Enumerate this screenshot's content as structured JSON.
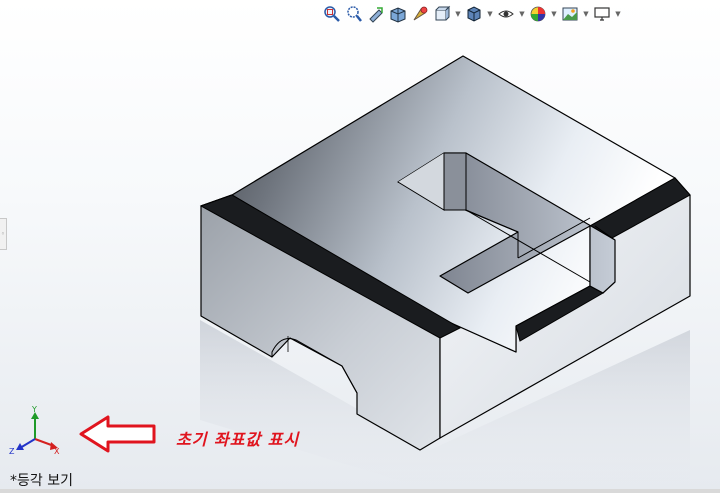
{
  "toolbar": {
    "icons": [
      {
        "name": "zoom-to-fit-icon",
        "caret": false
      },
      {
        "name": "zoom-to-area-icon",
        "caret": false
      },
      {
        "name": "previous-view-icon",
        "caret": false
      },
      {
        "name": "section-view-icon",
        "caret": false
      },
      {
        "name": "dynamic-annotation-icon",
        "caret": false
      },
      {
        "name": "view-orientation-icon",
        "caret": true
      },
      {
        "name": "display-style-icon",
        "caret": true
      },
      {
        "name": "hide-show-items-icon",
        "caret": true
      },
      {
        "name": "edit-appearance-icon",
        "caret": true
      },
      {
        "name": "apply-scene-icon",
        "caret": true
      },
      {
        "name": "view-settings-icon",
        "caret": true
      }
    ]
  },
  "triad": {
    "y_label": "Y",
    "x_label": "X",
    "z_label": "Z"
  },
  "annotation": {
    "text": "초기 좌표값 표시",
    "color": "#e0141e"
  },
  "view_label": "*등각 보기",
  "colors": {
    "axis_x": "#d42020",
    "axis_y": "#1e9a28",
    "axis_z": "#2233c8",
    "edge": "#000000"
  }
}
